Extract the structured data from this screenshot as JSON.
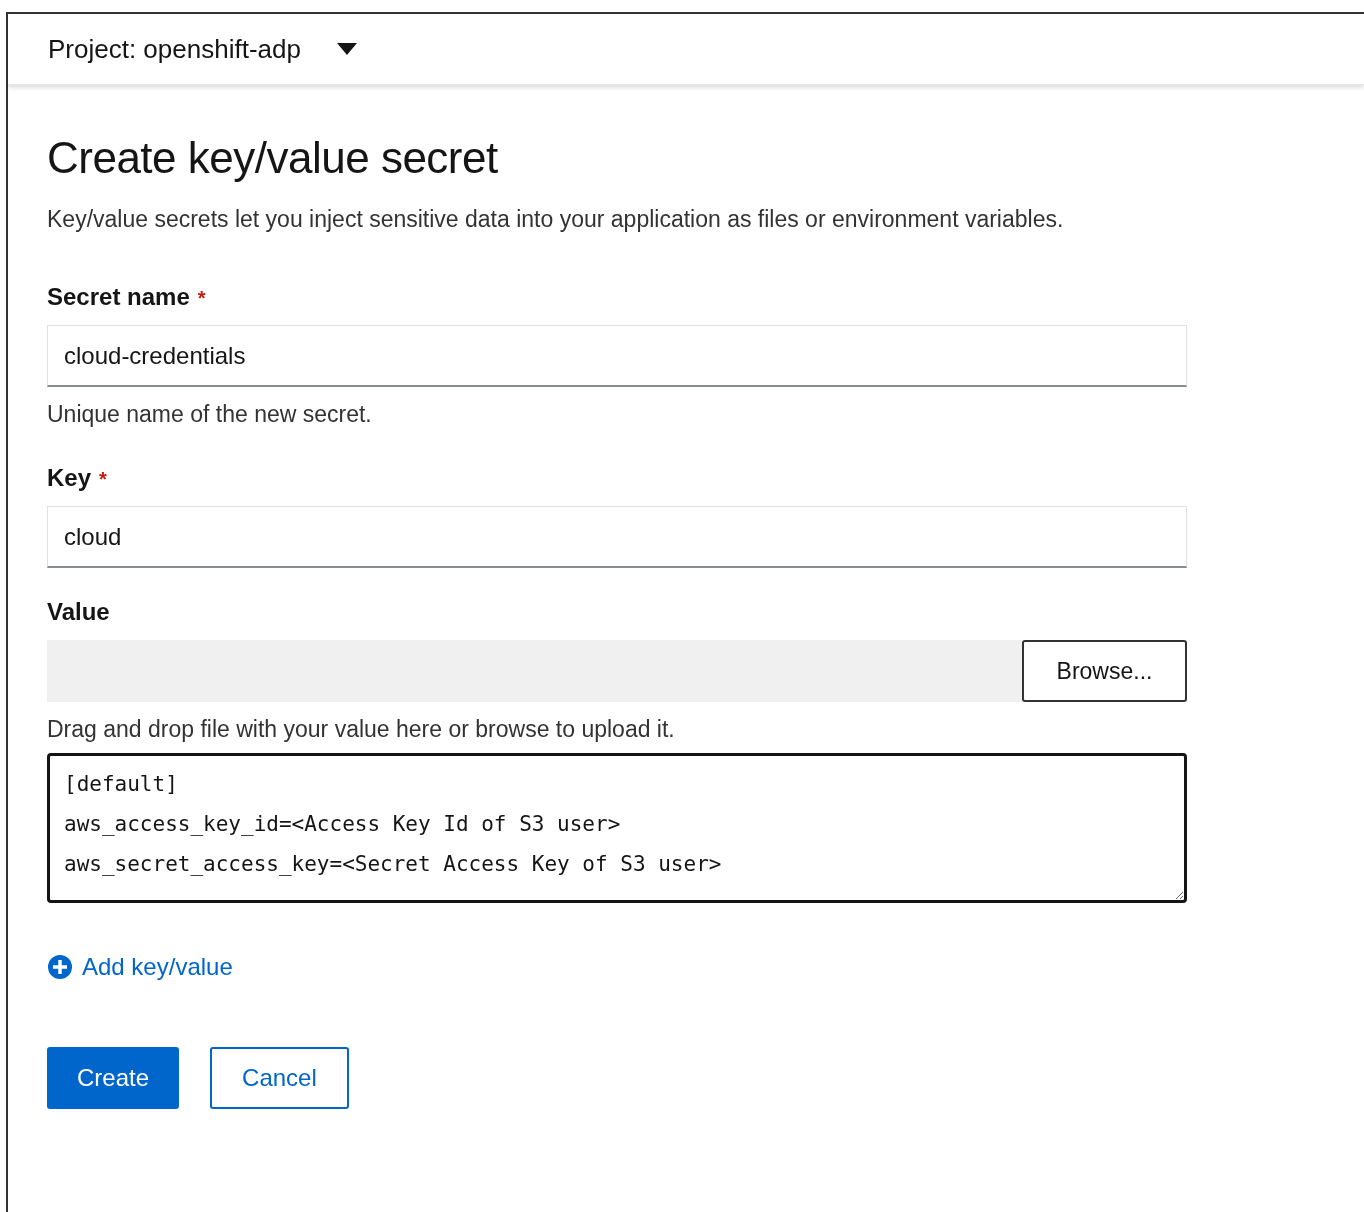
{
  "project_bar": {
    "label": "Project: openshift-adp"
  },
  "page": {
    "title": "Create key/value secret",
    "description": "Key/value secrets let you inject sensitive data into your application as files or environment variables."
  },
  "secret_name": {
    "label": "Secret name",
    "required_mark": "*",
    "value": "cloud-credentials",
    "helper": "Unique name of the new secret."
  },
  "key": {
    "label": "Key",
    "required_mark": "*",
    "value": "cloud"
  },
  "value": {
    "label": "Value",
    "browse_button": "Browse...",
    "helper": "Drag and drop file with your value here or browse to upload it.",
    "lines": [
      "[default]",
      "aws_access_key_id=<Access Key Id of S3 user>",
      "aws_secret_access_key=<Secret Access Key of S3 user>"
    ]
  },
  "add_link": "Add key/value",
  "buttons": [
    {
      "label": "Create",
      "kind": "primary"
    },
    {
      "label": "Cancel",
      "kind": "secondary"
    }
  ]
}
